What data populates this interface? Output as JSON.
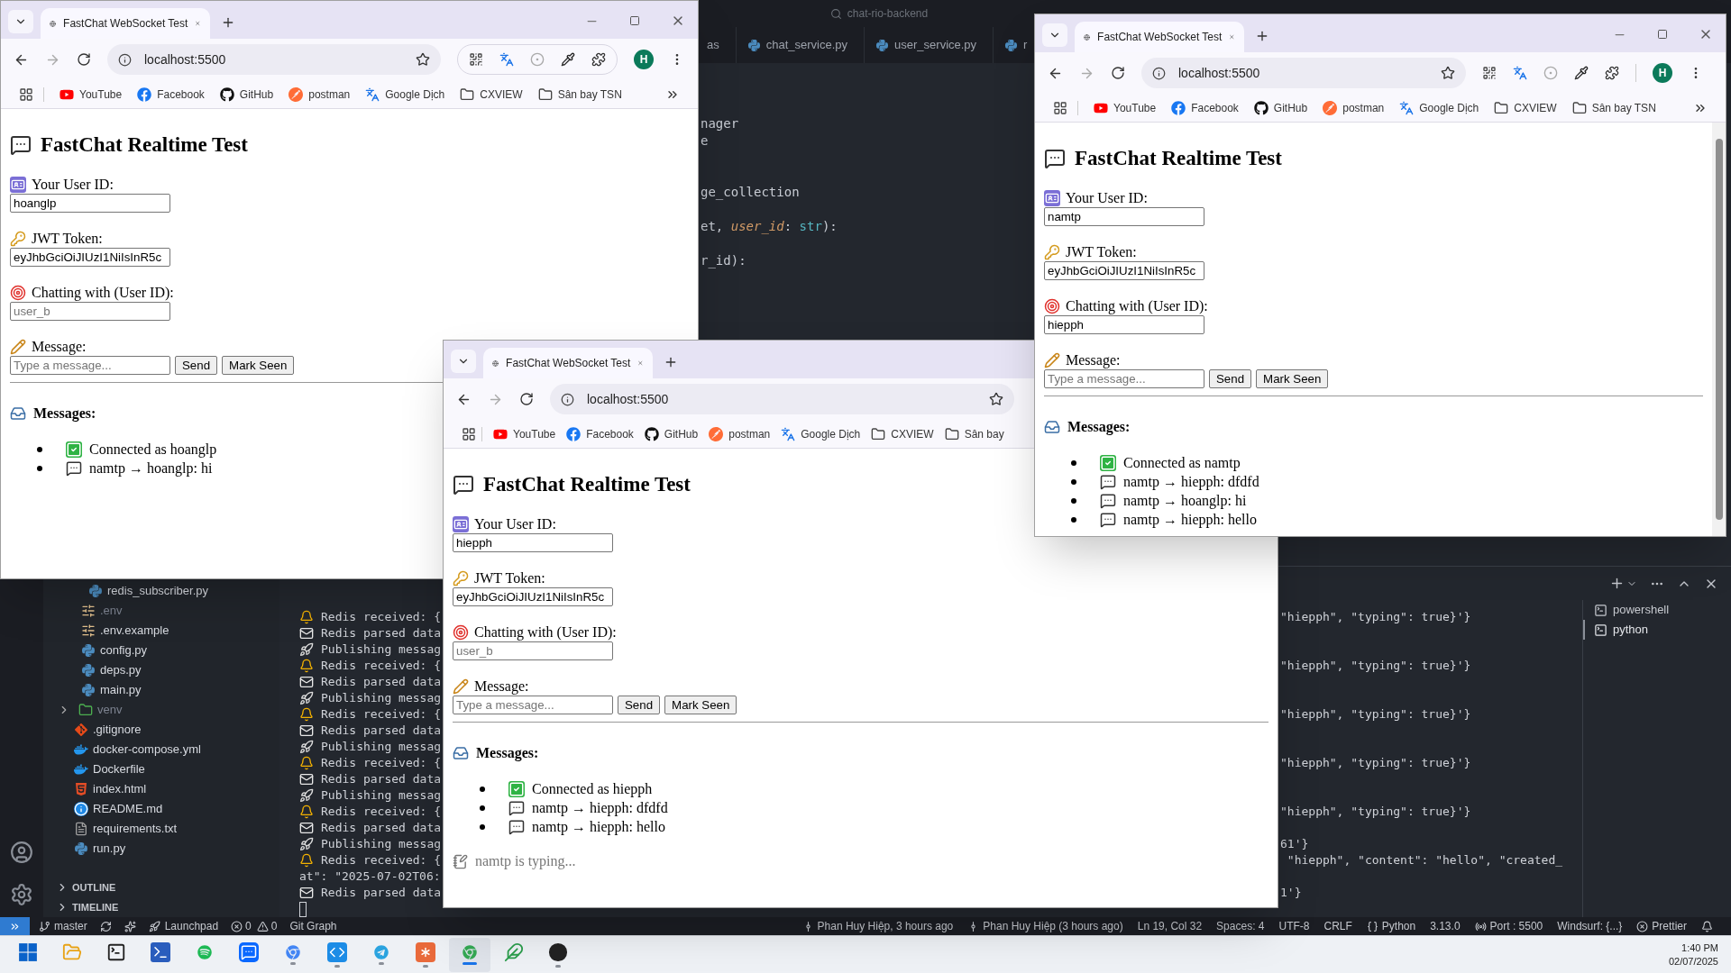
{
  "vscode": {
    "search": "chat-rio-backend",
    "editor_tabs": [
      {
        "label": "as",
        "kind": "plain"
      },
      {
        "label": "chat_service.py",
        "kind": "python"
      },
      {
        "label": "user_service.py",
        "kind": "python"
      },
      {
        "label": "r",
        "kind": "python"
      }
    ],
    "code_lines": [
      {
        "kind": "code",
        "tokens": [
          {
            "kind": "plain",
            "text": "nager"
          }
        ]
      },
      {
        "kind": "code",
        "tokens": [
          {
            "kind": "plain",
            "text": "e"
          }
        ]
      },
      {
        "kind": "blank"
      },
      {
        "kind": "blank"
      },
      {
        "kind": "code",
        "tokens": [
          {
            "kind": "plain",
            "text": "ge_collection"
          }
        ]
      },
      {
        "kind": "blank"
      },
      {
        "kind": "code",
        "tokens": [
          {
            "kind": "plain",
            "text": "et, "
          },
          {
            "kind": "param",
            "text": "user_id"
          },
          {
            "kind": "plain",
            "text": ": "
          },
          {
            "kind": "type",
            "text": "str"
          },
          {
            "kind": "plain",
            "text": "):"
          }
        ]
      },
      {
        "kind": "blank"
      },
      {
        "kind": "code",
        "tokens": [
          {
            "kind": "plain",
            "text": "r_id):"
          }
        ]
      }
    ],
    "explorer": {
      "items": [
        {
          "children": [
            {
              "children": [
                {
                  "name": "redis_subscriber.py",
                  "kind": "python",
                  "dimmed": false
                }
              ]
            },
            {
              "name": ".env",
              "kind": "env",
              "dimmed": true
            },
            {
              "name": ".env.example",
              "kind": "env",
              "dimmed": false
            },
            {
              "name": "config.py",
              "kind": "python",
              "dimmed": false
            },
            {
              "name": "deps.py",
              "kind": "python",
              "dimmed": false
            },
            {
              "name": "main.py",
              "kind": "python",
              "dimmed": false
            }
          ]
        },
        {
          "name": "venv",
          "kind": "folder",
          "dimmed": true,
          "expanded": false
        },
        {
          "name": ".gitignore",
          "kind": "git",
          "dimmed": false
        },
        {
          "name": "docker-compose.yml",
          "kind": "docker",
          "dimmed": false
        },
        {
          "name": "Dockerfile",
          "kind": "docker",
          "dimmed": false
        },
        {
          "name": "index.html",
          "kind": "html",
          "dimmed": false
        },
        {
          "name": "README.md",
          "kind": "info",
          "dimmed": false
        },
        {
          "name": "requirements.txt",
          "kind": "text",
          "dimmed": false
        },
        {
          "name": "run.py",
          "kind": "python",
          "dimmed": false
        }
      ],
      "sections": [
        {
          "label": "OUTLINE",
          "expanded": false
        },
        {
          "label": "TIMELINE",
          "expanded": false
        }
      ]
    },
    "terminal": {
      "lines": [
        {
          "kind": "received",
          "left": "Redis received: {",
          "right": "\"hiepph\", \"typing\": true}'}"
        },
        {
          "kind": "parsed",
          "left": "Redis parsed data"
        },
        {
          "kind": "publishing",
          "left": "Publishing messag"
        },
        {
          "kind": "received",
          "left": "Redis received: {",
          "right": "\"hiepph\", \"typing\": true}'}"
        },
        {
          "kind": "parsed",
          "left": "Redis parsed data"
        },
        {
          "kind": "publishing",
          "left": "Publishing messag"
        },
        {
          "kind": "received",
          "left": "Redis received: {",
          "right": "\"hiepph\", \"typing\": true}'}"
        },
        {
          "kind": "parsed",
          "left": "Redis parsed data"
        },
        {
          "kind": "publishing",
          "left": "Publishing messag"
        },
        {
          "kind": "received",
          "left": "Redis received: {",
          "right": "\"hiepph\", \"typing\": true}'}"
        },
        {
          "kind": "parsed",
          "left": "Redis parsed data"
        },
        {
          "kind": "publishing",
          "left": "Publishing messag"
        },
        {
          "kind": "received",
          "left": "Redis received: {",
          "right": "\"hiepph\", \"typing\": true}'}"
        },
        {
          "kind": "parsed",
          "left": "Redis parsed data"
        },
        {
          "kind": "publishing",
          "left": "Publishing messag",
          "right": "61'}"
        },
        {
          "kind": "received",
          "left": "Redis received: {",
          "right": " \"hiepph\", \"content\": \"hello\", \"created_"
        },
        {
          "kind": "continuation",
          "left": "at\": \"2025-07-02T06:"
        },
        {
          "kind": "parsed",
          "left": "Redis parsed data",
          "right": "1'}"
        },
        {
          "kind": "cursor"
        }
      ],
      "sessions": [
        {
          "label": "powershell",
          "selected": false
        },
        {
          "label": "python",
          "selected": true
        }
      ]
    },
    "status_bar": {
      "left": [
        {
          "kind": "branch",
          "text": "master"
        },
        {
          "kind": "launchpad",
          "text": "Launchpad"
        },
        {
          "kind": "problems",
          "errors": "0",
          "warnings": "0"
        },
        {
          "kind": "plain",
          "text": "Git Graph"
        }
      ],
      "right": [
        {
          "kind": "blame",
          "text": "Phan Huy Hiệp, 3 hours ago"
        },
        {
          "kind": "blame",
          "text": "Phan Huy Hiệp (3 hours ago)"
        },
        {
          "kind": "plain",
          "text": "Ln 19, Col 32"
        },
        {
          "kind": "plain",
          "text": "Spaces: 4"
        },
        {
          "kind": "plain",
          "text": "UTF-8"
        },
        {
          "kind": "plain",
          "text": "CRLF"
        },
        {
          "kind": "language",
          "text": "Python"
        },
        {
          "kind": "plain",
          "text": "3.13.0"
        },
        {
          "kind": "port",
          "text": "Port : 5500"
        },
        {
          "kind": "plain",
          "text": "Windsurf: {...}"
        },
        {
          "kind": "check",
          "text": "Prettier"
        }
      ]
    }
  },
  "windows": [
    {
      "tab_title": "FastChat WebSocket Test",
      "window_controls": true,
      "url": "localhost:5500",
      "extensions_grouped": true,
      "avatar": "H",
      "bookmarks": [
        {
          "label": "YouTube",
          "kind": "youtube"
        },
        {
          "label": "Facebook",
          "kind": "facebook"
        },
        {
          "label": "GitHub",
          "kind": "github"
        },
        {
          "label": "postman",
          "kind": "postman"
        },
        {
          "label": "Google Dịch",
          "kind": "translate"
        },
        {
          "label": "CXVIEW",
          "kind": "folder"
        },
        {
          "label": "Sân bay TSN",
          "kind": "folder"
        }
      ],
      "bookmarks_more": true,
      "heading": "FastChat Realtime Test",
      "fields": [
        {
          "kind": "user",
          "label": "Your User ID:",
          "value": "hoanglp"
        },
        {
          "kind": "token",
          "label": "JWT Token:",
          "value": "eyJhbGciOiJIUzI1NiIsInR5c"
        },
        {
          "kind": "target",
          "label": "Chatting with (User ID):",
          "placeholder": "user_b"
        },
        {
          "kind": "message",
          "label": "Message:",
          "placeholder": "Type a message..."
        }
      ],
      "buttons": [
        "Send",
        "Mark Seen"
      ],
      "messages_title": "Messages:",
      "messages": [
        {
          "kind": "status",
          "text": "Connected as hoanglp"
        },
        {
          "kind": "chat",
          "text": "namtp → hoanglp: hi"
        }
      ]
    },
    {
      "tab_title": "FastChat WebSocket Test",
      "url": "localhost:5500",
      "bookmarks": [
        {
          "label": "YouTube",
          "kind": "youtube"
        },
        {
          "label": "Facebook",
          "kind": "facebook"
        },
        {
          "label": "GitHub",
          "kind": "github"
        },
        {
          "label": "postman",
          "kind": "postman"
        },
        {
          "label": "Google Dịch",
          "kind": "translate"
        },
        {
          "label": "CXVIEW",
          "kind": "folder"
        },
        {
          "label": "Sân bay",
          "kind": "folder"
        }
      ],
      "heading": "FastChat Realtime Test",
      "fields": [
        {
          "kind": "user",
          "label": "Your User ID:",
          "value": "hiepph"
        },
        {
          "kind": "token",
          "label": "JWT Token:",
          "value": "eyJhbGciOiJIUzI1NiIsInR5c"
        },
        {
          "kind": "target",
          "label": "Chatting with (User ID):",
          "placeholder": "user_b"
        },
        {
          "kind": "message",
          "label": "Message:",
          "placeholder": "Type a message..."
        }
      ],
      "buttons": [
        "Send",
        "Mark Seen"
      ],
      "messages_title": "Messages:",
      "messages": [
        {
          "kind": "status",
          "text": "Connected as hiepph"
        },
        {
          "kind": "chat",
          "text": "namtp → hiepph: dfdfd"
        },
        {
          "kind": "chat",
          "text": "namtp → hiepph: hello"
        }
      ],
      "typing": "namtp is typing..."
    },
    {
      "tab_title": "FastChat WebSocket Test",
      "window_controls": true,
      "url": "localhost:5500",
      "extensions_grouped": false,
      "avatar": "H",
      "scrollbar": true,
      "bookmarks": [
        {
          "label": "YouTube",
          "kind": "youtube"
        },
        {
          "label": "Facebook",
          "kind": "facebook"
        },
        {
          "label": "GitHub",
          "kind": "github"
        },
        {
          "label": "postman",
          "kind": "postman"
        },
        {
          "label": "Google Dịch",
          "kind": "translate"
        },
        {
          "label": "CXVIEW",
          "kind": "folder"
        },
        {
          "label": "Sân bay TSN",
          "kind": "folder"
        }
      ],
      "bookmarks_more": true,
      "heading": "FastChat Realtime Test",
      "fields": [
        {
          "kind": "user",
          "label": "Your User ID:",
          "value": "namtp"
        },
        {
          "kind": "token",
          "label": "JWT Token:",
          "value": "eyJhbGciOiJIUzI1NiIsInR5c"
        },
        {
          "kind": "target",
          "label": "Chatting with (User ID):",
          "value": "hiepph"
        },
        {
          "kind": "message",
          "label": "Message:",
          "placeholder": "Type a message..."
        }
      ],
      "buttons": [
        "Send",
        "Mark Seen"
      ],
      "messages_title": "Messages:",
      "messages": [
        {
          "kind": "status",
          "text": "Connected as namtp"
        },
        {
          "kind": "chat",
          "text": "namtp → hiepph: dfdfd"
        },
        {
          "kind": "chat",
          "text": "namtp → hoanglp: hi"
        },
        {
          "kind": "chat",
          "text": "namtp → hiepph: hello"
        }
      ]
    }
  ],
  "taskbar": {
    "apps": [
      {
        "running": false,
        "selected": false
      },
      {
        "running": false,
        "selected": false
      },
      {
        "running": false,
        "selected": false
      },
      {
        "running": false,
        "selected": false
      },
      {
        "running": false,
        "selected": false
      },
      {
        "running": false,
        "selected": false
      },
      {
        "running": true,
        "selected": false
      },
      {
        "running": true,
        "selected": false
      },
      {
        "running": true,
        "selected": false
      },
      {
        "running": true,
        "selected": false
      },
      {
        "running": true,
        "selected": true
      },
      {
        "running": false,
        "selected": false
      },
      {
        "running": true,
        "selected": false
      }
    ],
    "time": "1:40 PM",
    "date": "02/07/2025"
  }
}
